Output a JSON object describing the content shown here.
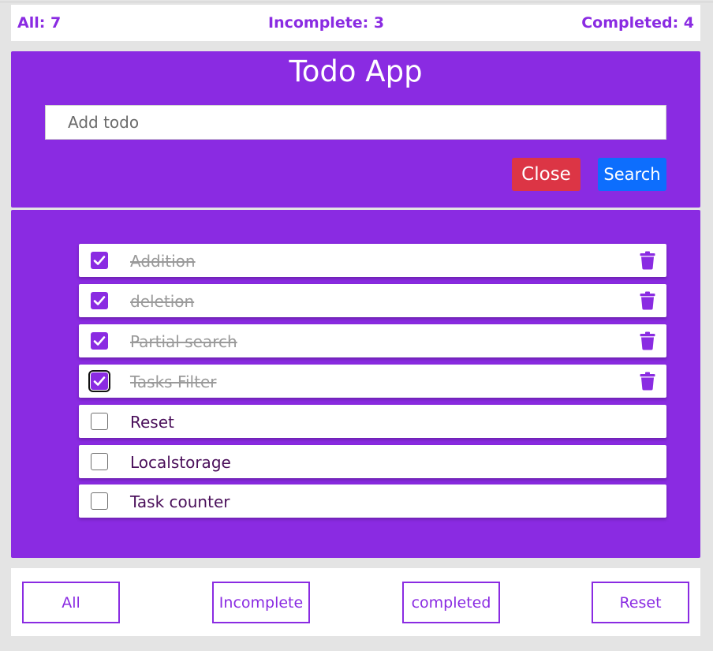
{
  "counters": {
    "all": "All: 7",
    "incomplete": "Incomplete: 3",
    "completed": "Completed: 4"
  },
  "header": {
    "title": "Todo App",
    "input_placeholder": "Add todo",
    "input_value": "",
    "close_label": "Close",
    "search_label": "Search"
  },
  "todos": [
    {
      "text": "Addition",
      "completed": true
    },
    {
      "text": "deletion",
      "completed": true
    },
    {
      "text": "Partial search",
      "completed": true
    },
    {
      "text": "Tasks Filter",
      "completed": true
    },
    {
      "text": "Reset",
      "completed": false
    },
    {
      "text": "Localstorage",
      "completed": false
    },
    {
      "text": "Task counter",
      "completed": false
    }
  ],
  "footer": {
    "all_label": "All",
    "incomplete_label": "Incomplete",
    "completed_label": "completed",
    "reset_label": "Reset"
  },
  "icons": {
    "delete": "trash-icon",
    "check": "checkmark-icon"
  },
  "colors": {
    "accent": "#8a2be2",
    "close_button": "#dc3545",
    "search_button": "#0d6efd",
    "completed_text": "#9a9a9a",
    "open_text": "#4a0f5a"
  }
}
